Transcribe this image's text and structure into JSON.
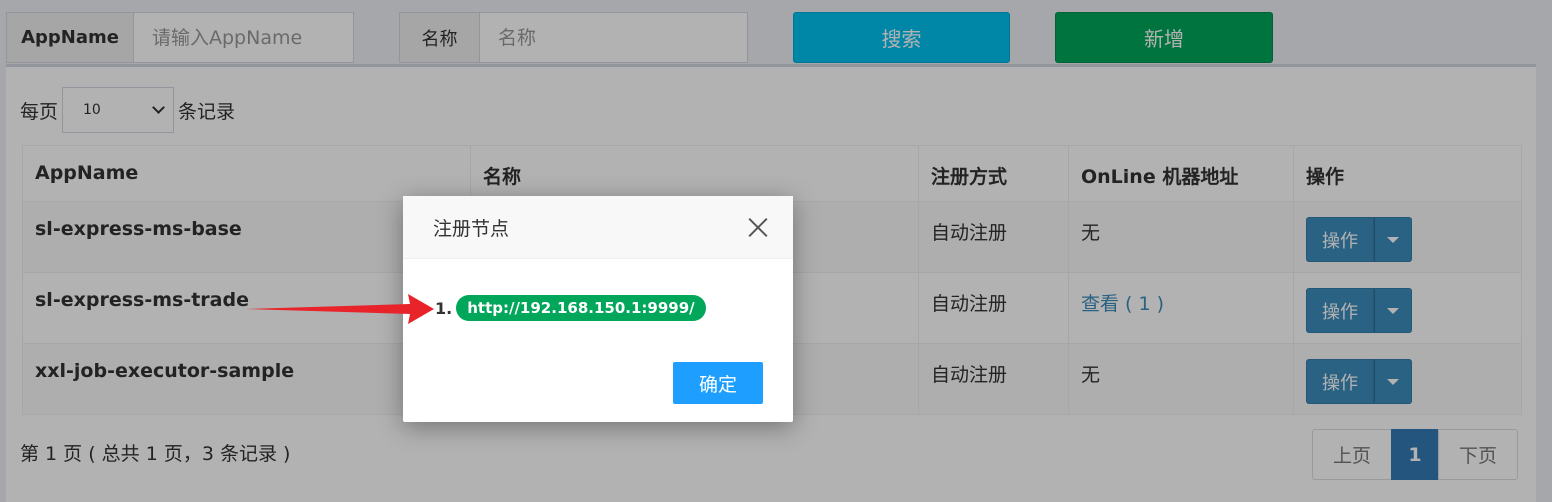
{
  "search": {
    "appname_label": "AppName",
    "appname_placeholder": "请输入AppName",
    "title_label": "名称",
    "title_placeholder": "名称",
    "search_button": "搜索",
    "add_button": "新增"
  },
  "length_menu": {
    "prefix": "每页",
    "value": "10",
    "suffix": "条记录"
  },
  "table": {
    "headers": [
      "AppName",
      "名称",
      "注册方式",
      "OnLine 机器地址",
      "操作"
    ],
    "rows": [
      {
        "appname": "sl-express-ms-base",
        "title": "",
        "register": "自动注册",
        "online": "无",
        "online_link": false,
        "action": "操作"
      },
      {
        "appname": "sl-express-ms-trade",
        "title": "",
        "register": "自动注册",
        "online": "查看 ( 1 )",
        "online_link": true,
        "action": "操作"
      },
      {
        "appname": "xxl-job-executor-sample",
        "title": "",
        "register": "自动注册",
        "online": "无",
        "online_link": false,
        "action": "操作"
      }
    ]
  },
  "footer": {
    "info": "第 1 页 ( 总共 1 页，3 条记录 )",
    "prev": "上页",
    "current": "1",
    "next": "下页"
  },
  "modal": {
    "title": "注册节点",
    "item_number": "1.",
    "address": "http://192.168.150.1:9999/",
    "confirm": "确定"
  },
  "colors": {
    "search_button": "#00c0ef",
    "add_button": "#00a65a",
    "action_button": "#3c8dbc",
    "badge": "#00a65a",
    "confirm": "#1e9fff",
    "arrow": "#e8232a"
  }
}
